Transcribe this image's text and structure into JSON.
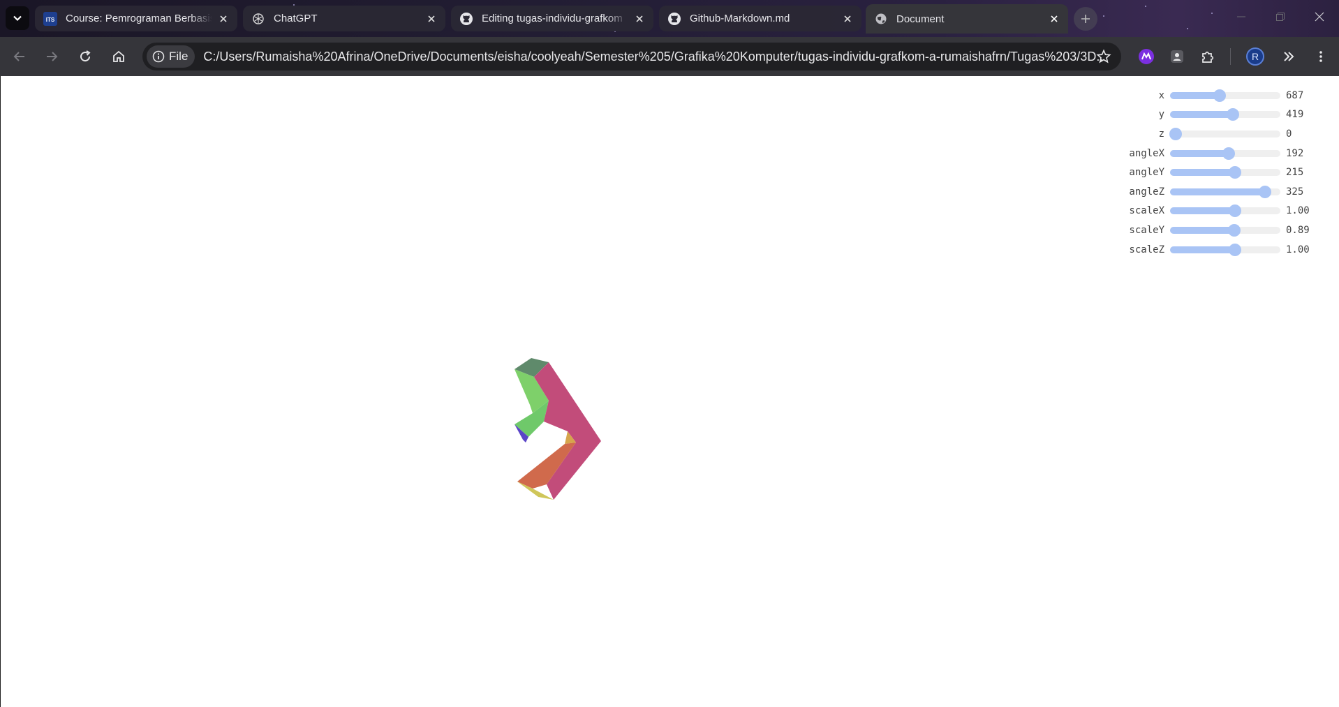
{
  "browser": {
    "tabs": [
      {
        "title": "Course: Pemrograman Berbasis",
        "favicon": "its-icon",
        "active": false
      },
      {
        "title": "ChatGPT",
        "favicon": "chatgpt-icon",
        "active": false
      },
      {
        "title": "Editing tugas-individu-grafkom",
        "favicon": "github-icon",
        "active": false
      },
      {
        "title": "Github-Markdown.md",
        "favicon": "github-icon",
        "active": false
      },
      {
        "title": "Document",
        "favicon": "globe-icon",
        "active": true
      }
    ],
    "favicon_its_text": "ITS",
    "address": {
      "scheme_label": "File",
      "url": "C:/Users/Rumaisha%20Afrina/OneDrive/Documents/eisha/coolyeah/Semester%205/Grafika%20Komputer/tugas-individu-grafkom-a-rumaishafrn/Tugas%203/3D..."
    },
    "profile_initial": "R"
  },
  "controls": [
    {
      "label": "x",
      "value": "687",
      "fraction": 0.45
    },
    {
      "label": "y",
      "value": "419",
      "fraction": 0.57
    },
    {
      "label": "z",
      "value": "0",
      "fraction": 0.05
    },
    {
      "label": "angleX",
      "value": "192",
      "fraction": 0.53
    },
    {
      "label": "angleY",
      "value": "215",
      "fraction": 0.59
    },
    {
      "label": "angleZ",
      "value": "325",
      "fraction": 0.86
    },
    {
      "label": "scaleX",
      "value": "1.00",
      "fraction": 0.59
    },
    {
      "label": "scaleY",
      "value": "0.89",
      "fraction": 0.58
    },
    {
      "label": "scaleZ",
      "value": "1.00",
      "fraction": 0.59
    }
  ],
  "colors": {
    "slider_accent": "#a9c4f5",
    "face_magenta": "#c24c7a",
    "face_green": "#7ed06a",
    "face_darkgreen": "#5f8a6b",
    "face_blue": "#5a44c8",
    "face_orange": "#d06a4c",
    "face_yellow": "#cfc65a",
    "face_tan": "#d6a54c"
  }
}
